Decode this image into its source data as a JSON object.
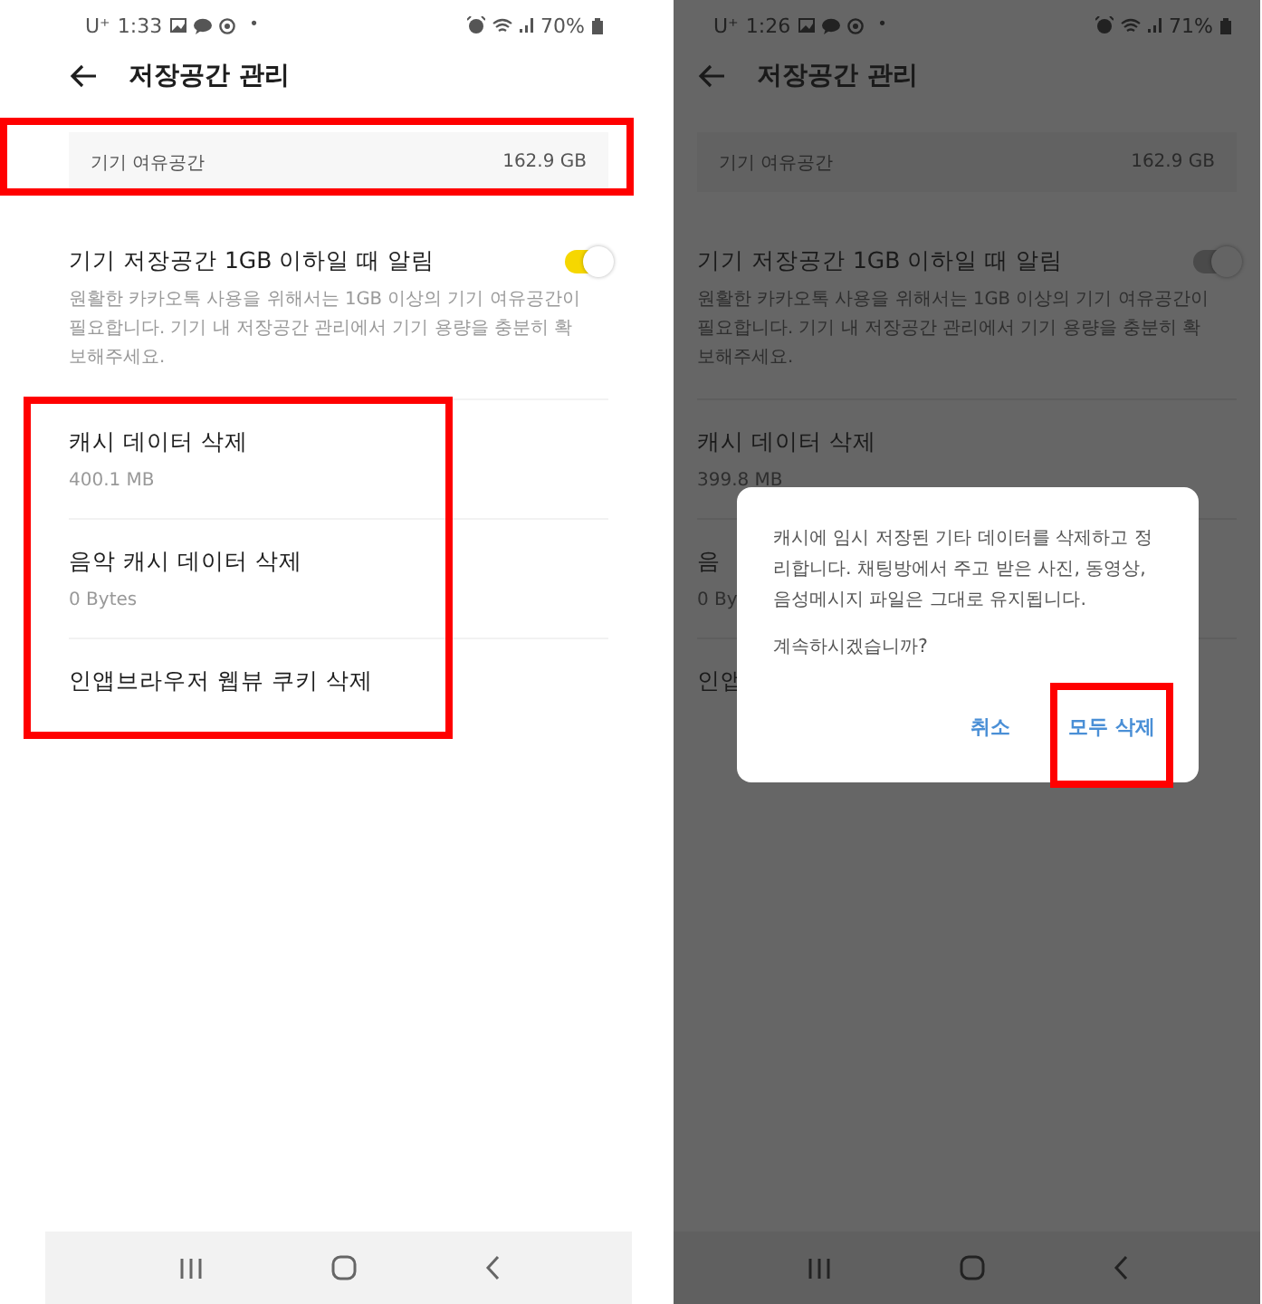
{
  "screens": [
    {
      "dimmed": false,
      "status": {
        "carrier": "U⁺",
        "time": "1:33",
        "dot": "•",
        "battery": "70%"
      },
      "title": "저장공간 관리",
      "free_space": {
        "label": "기기 여유공간",
        "value": "162.9 GB",
        "highlighted": true
      },
      "alert": {
        "title": "기기 저장공간 1GB 이하일 때 알림",
        "description": "원활한 카카오톡 사용을 위해서는 1GB 이상의 기기 여유공간이 필요합니다. 기기 내 저장공간 관리에서 기기 용량을 충분히 확보해주세요.",
        "on": true
      },
      "items_highlighted": true,
      "items": [
        {
          "title": "캐시 데이터 삭제",
          "subtitle": "400.1 MB"
        },
        {
          "title": "음악 캐시 데이터 삭제",
          "subtitle": "0 Bytes"
        },
        {
          "title": "인앱브라우저 웹뷰 쿠키 삭제"
        }
      ]
    },
    {
      "dimmed": true,
      "status": {
        "carrier": "U⁺",
        "time": "1:26",
        "dot": "•",
        "battery": "71%"
      },
      "title": "저장공간 관리",
      "free_space": {
        "label": "기기 여유공간",
        "value": "162.9 GB",
        "highlighted": false
      },
      "alert": {
        "title": "기기 저장공간 1GB 이하일 때 알림",
        "description": "원활한 카카오톡 사용을 위해서는 1GB 이상의 기기 여유공간이 필요합니다. 기기 내 저장공간 관리에서 기기 용량을 충분히 확보해주세요.",
        "on": true
      },
      "items_highlighted": false,
      "items": [
        {
          "title": "캐시 데이터 삭제",
          "subtitle": "399.8 MB"
        },
        {
          "title": "음",
          "subtitle": "0 By"
        },
        {
          "title": "인앱"
        }
      ],
      "dialog": {
        "message": "캐시에 임시 저장된 기타 데이터를 삭제하고 정리합니다. 채팅방에서 주고 받은 사진, 동영상, 음성메시지 파일은 그대로 유지됩니다.",
        "question": "계속하시겠습니까?",
        "buttons": [
          {
            "label": "취소",
            "highlighted": false
          },
          {
            "label": "모두 삭제",
            "highlighted": true
          }
        ]
      }
    }
  ]
}
